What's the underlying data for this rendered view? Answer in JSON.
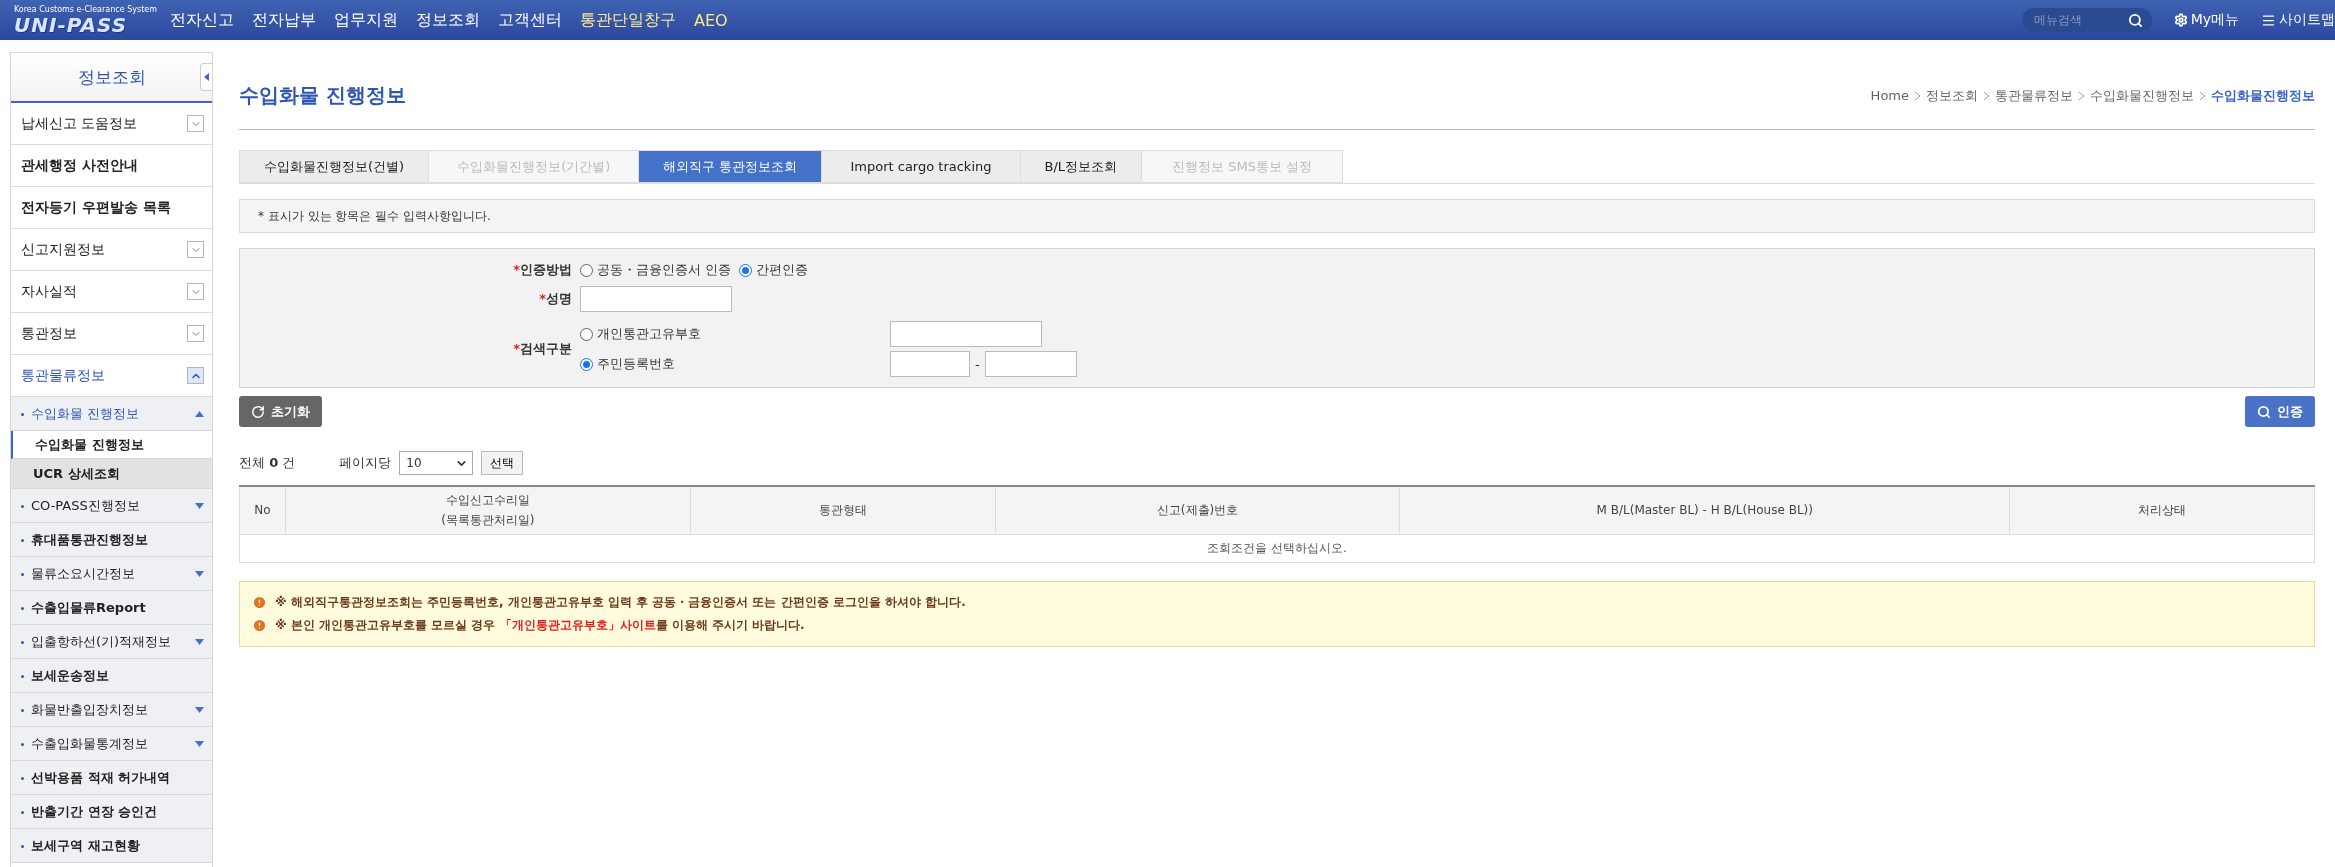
{
  "header": {
    "logo_caption": "Korea Customs e-Clearance System",
    "logo": "UNI-PASS",
    "nav": [
      {
        "label": "전자신고",
        "highlight": false
      },
      {
        "label": "전자납부",
        "highlight": false
      },
      {
        "label": "업무지원",
        "highlight": false
      },
      {
        "label": "정보조회",
        "highlight": false
      },
      {
        "label": "고객센터",
        "highlight": false
      },
      {
        "label": "통관단일창구",
        "highlight": true
      },
      {
        "label": "AEO",
        "highlight": true
      }
    ],
    "search": {
      "placeholder": "메뉴검색"
    },
    "my_menu": "My메뉴",
    "sitemap": "사이트맵"
  },
  "sidebar": {
    "title": "정보조회",
    "items": [
      {
        "label": "납세신고 도움정보",
        "kind": "group",
        "expanded": false
      },
      {
        "label": "관세행정 사전안내",
        "kind": "link"
      },
      {
        "label": "전자등기 우편발송 목록",
        "kind": "link"
      },
      {
        "label": "신고지원정보",
        "kind": "group",
        "expanded": false
      },
      {
        "label": "자사실적",
        "kind": "group",
        "expanded": false
      },
      {
        "label": "통관정보",
        "kind": "group",
        "expanded": false
      },
      {
        "label": "통관물류정보",
        "kind": "group",
        "expanded": true,
        "children": [
          {
            "label": "수입화물 진행정보",
            "kind": "group",
            "expanded": true,
            "children": [
              {
                "label": "수입화물 진행정보",
                "selected": true
              },
              {
                "label": "UCR 상세조회",
                "selected": false
              }
            ]
          },
          {
            "label": "CO-PASS진행정보",
            "kind": "group",
            "expanded": false
          },
          {
            "label": "휴대품통관진행정보",
            "kind": "link"
          },
          {
            "label": "물류소요시간정보",
            "kind": "group",
            "expanded": false
          },
          {
            "label": "수출입물류Report",
            "kind": "link"
          },
          {
            "label": "입출항하선(기)적재정보",
            "kind": "group",
            "expanded": false
          },
          {
            "label": "보세운송정보",
            "kind": "link"
          },
          {
            "label": "화물반출입장치정보",
            "kind": "group",
            "expanded": false
          },
          {
            "label": "수출입화물통계정보",
            "kind": "group",
            "expanded": false
          },
          {
            "label": "선박용품 적재 허가내역",
            "kind": "link"
          },
          {
            "label": "반출기간 연장 승인건",
            "kind": "link"
          },
          {
            "label": "보세구역 재고현황",
            "kind": "link"
          }
        ]
      }
    ]
  },
  "page": {
    "title": "수입화물 진행정보",
    "breadcrumb": [
      "Home",
      "정보조회",
      "통관물류정보",
      "수입화물진행정보",
      "수입화물진행정보"
    ]
  },
  "tabs": [
    {
      "label": "수입화물진행정보(건별)",
      "selected": false,
      "disabled": false
    },
    {
      "label": "수입화물진행정보(기간별)",
      "selected": false,
      "disabled": true
    },
    {
      "label": "해외직구 통관정보조회",
      "selected": true,
      "disabled": false
    },
    {
      "label": "Import cargo tracking",
      "selected": false,
      "disabled": false
    },
    {
      "label": "B/L정보조회",
      "selected": false,
      "disabled": false
    },
    {
      "label": "진행정보 SMS통보 설정",
      "selected": false,
      "disabled": true
    }
  ],
  "required_notice": "* 표시가 있는 항목은 필수 입력사항입니다.",
  "form": [
    {
      "kind": "radio",
      "mark": "*",
      "label": "인증방법",
      "options": [
        {
          "label": "공동・금융인증서 인증",
          "selected": false
        },
        {
          "label": "간편인증",
          "selected": true
        }
      ]
    },
    {
      "kind": "text",
      "mark": "*",
      "label": "성명"
    },
    {
      "kind": "choice",
      "mark": "*",
      "label": "검색구분",
      "options": [
        {
          "label": "개인통관고유부호",
          "selected": false,
          "split": false
        },
        {
          "label": "주민등록번호",
          "selected": true,
          "split": true,
          "separator": "-"
        }
      ]
    }
  ],
  "reset_button": "초기화",
  "auth_button": "인증",
  "list": {
    "count": "전체 **0** 건",
    "per_page_label": "페이지당",
    "per_page": "10",
    "select_button": "선택"
  },
  "table": {
    "columns": [
      [
        "No"
      ],
      [
        "수입신고수리일",
        "(목록통관처리일)"
      ],
      [
        "통관형태"
      ],
      [
        "신고(제출)번호"
      ],
      [
        "M B/L(Master BL) - H B/L(House BL))"
      ],
      [
        "처리상태"
      ]
    ],
    "empty": "조회조건을 선택하십시오."
  },
  "notes": [
    [
      {
        "kind": "plain",
        "text": "※ 해외직구통관정보조회는 주민등록번호, 개인통관고유부호 입력 후 공동・금융인증서 또는 간편인증 로그인을 하셔야 합니다."
      }
    ],
    [
      {
        "kind": "plain",
        "text": "※ 본인 개인통관고유부호를 모르실 경우 "
      },
      {
        "kind": "link",
        "text": "「개인통관고유부호」사이트"
      },
      {
        "kind": "plain",
        "text": "를 이용해 주시기 바랍니다."
      }
    ]
  ]
}
